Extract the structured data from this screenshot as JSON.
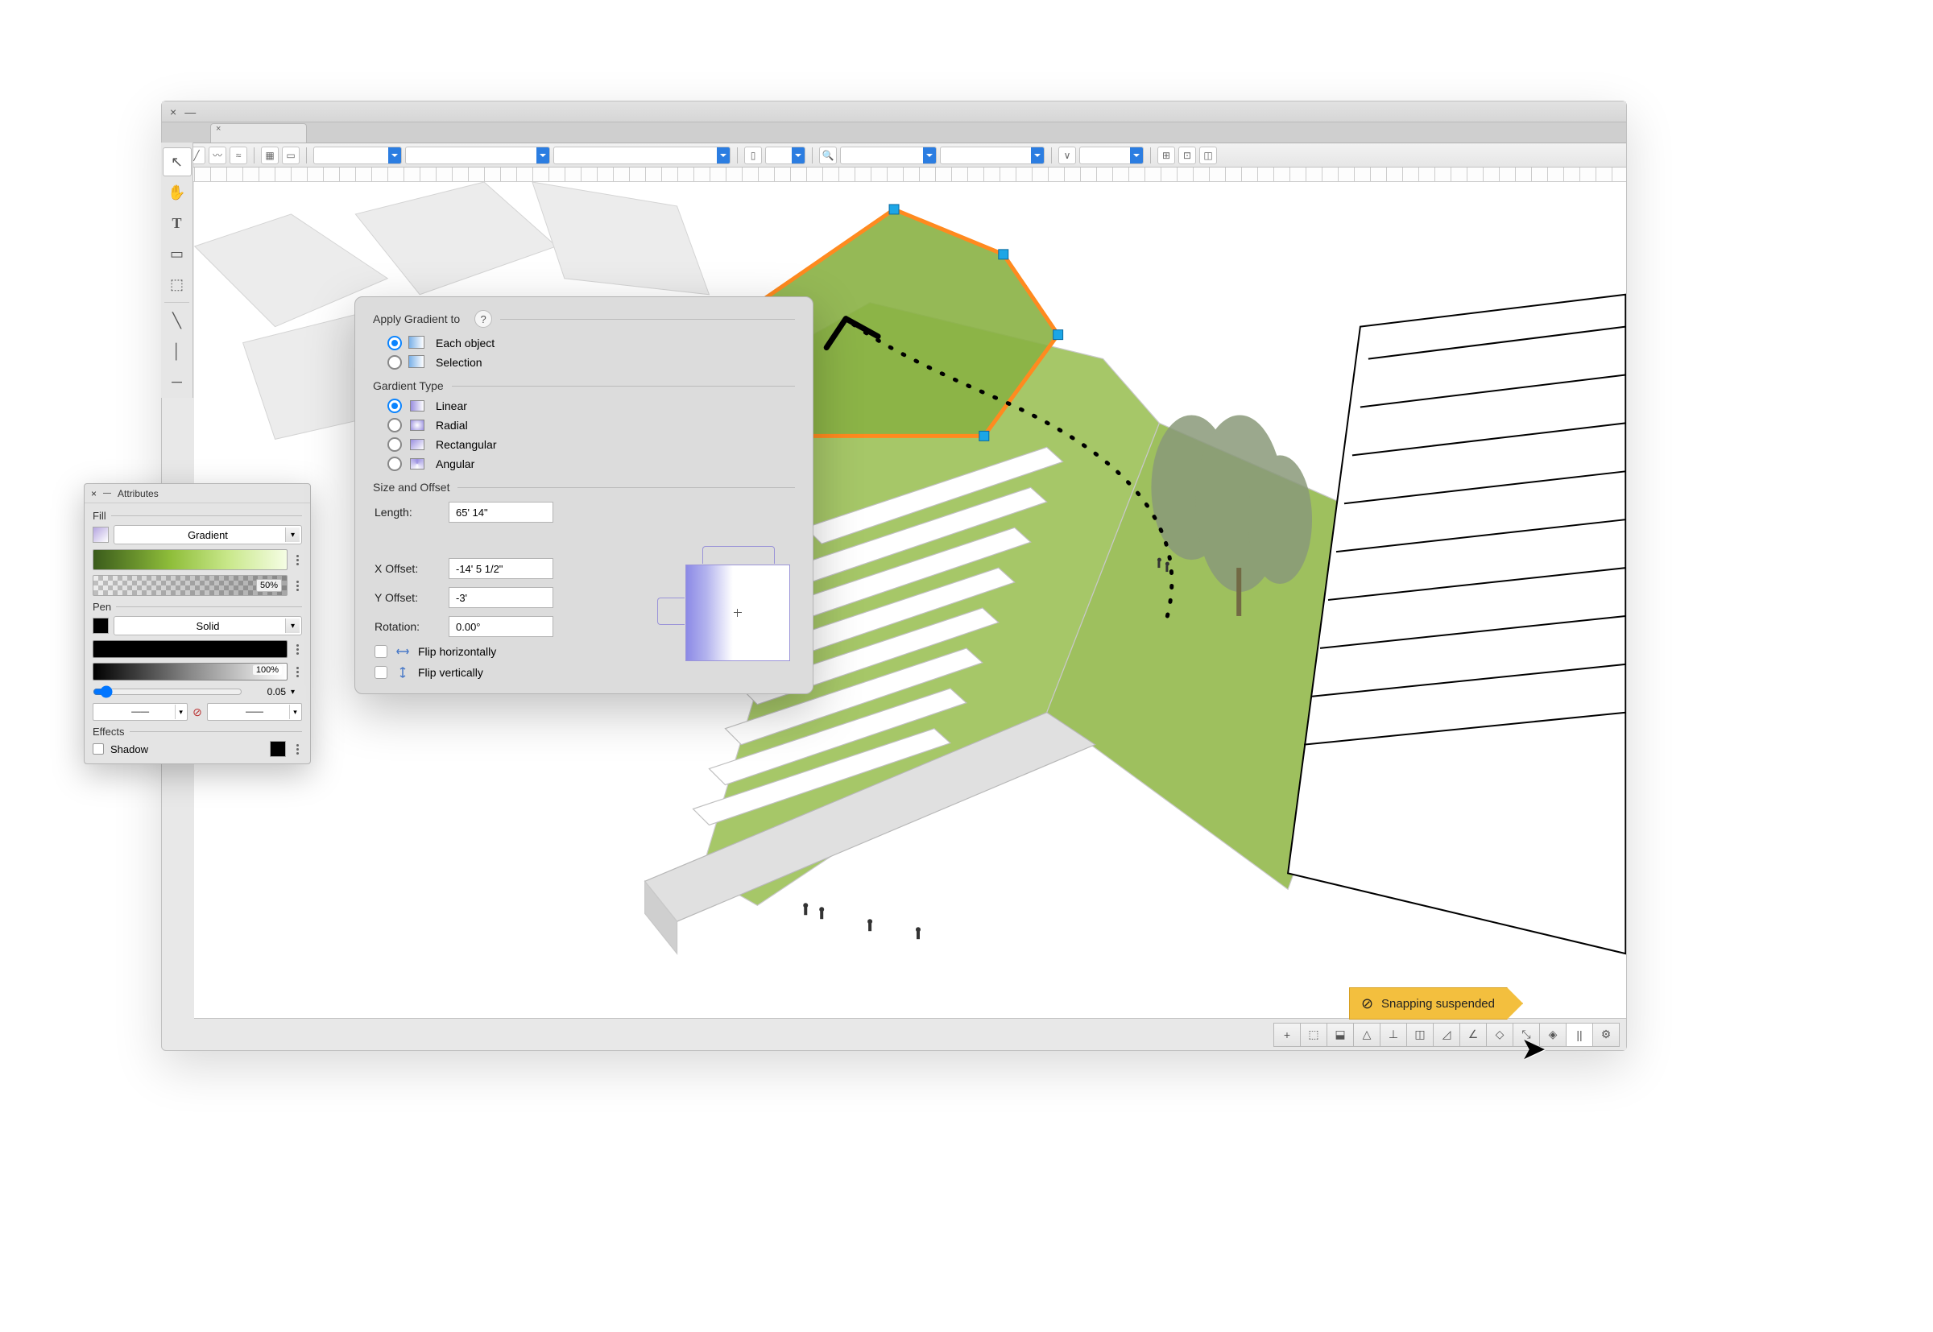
{
  "window": {
    "close_label": "×",
    "min_label": "—",
    "title": ""
  },
  "tabs": [
    {
      "close": "×"
    }
  ],
  "tool_palette": [
    {
      "name": "selection-tool",
      "glyph": "↖"
    },
    {
      "name": "pan-tool",
      "glyph": "✋"
    },
    {
      "name": "text-tool",
      "glyph": "T"
    },
    {
      "name": "rect-tool",
      "glyph": "▭"
    },
    {
      "name": "layer-tool",
      "glyph": "⬚"
    },
    {
      "name": "line-tool-1",
      "glyph": "╲"
    },
    {
      "name": "line-tool-2",
      "glyph": "│"
    },
    {
      "name": "line-tool-3",
      "glyph": "─"
    }
  ],
  "attributes": {
    "title": "Attributes",
    "fill": {
      "label": "Fill",
      "type": "Gradient",
      "opacity": "50%"
    },
    "pen": {
      "label": "Pen",
      "type": "Solid",
      "opacity": "100%",
      "width": "0.05"
    },
    "effects": {
      "label": "Effects",
      "shadow_label": "Shadow"
    }
  },
  "gradient_dialog": {
    "apply_label": "Apply Gradient to",
    "help": "?",
    "apply_options": [
      {
        "label": "Each object",
        "selected": true
      },
      {
        "label": "Selection",
        "selected": false
      }
    ],
    "type_label": "Gardient Type",
    "type_options": [
      {
        "label": "Linear",
        "selected": true,
        "kind": "linear"
      },
      {
        "label": "Radial",
        "selected": false,
        "kind": "radial"
      },
      {
        "label": "Rectangular",
        "selected": false,
        "kind": "rect"
      },
      {
        "label": "Angular",
        "selected": false,
        "kind": "ang"
      }
    ],
    "size_label": "Size and Offset",
    "fields": {
      "length_label": "Length:",
      "length": "65' 14\"",
      "x_offset_label": "X Offset:",
      "x_offset": "-14' 5 1/2\"",
      "y_offset_label": "Y Offset:",
      "y_offset": "-3'",
      "rotation_label": "Rotation:",
      "rotation": "0.00°"
    },
    "flip_h": "Flip horizontally",
    "flip_v": "Flip vertically"
  },
  "snapping": {
    "tooltip": "Snapping suspended",
    "buttons": [
      "+",
      "⬚",
      "⬓",
      "△",
      "⊥",
      "◫",
      "◿",
      "∠",
      "◇",
      "⤡",
      "◈",
      "||",
      "⚙"
    ]
  },
  "colors": {
    "accent": "#0b84ff",
    "selection_orange": "#ff8a1f",
    "handle_blue": "#1ca6e6",
    "grass_light": "#9fbf5a",
    "grass_dark": "#6e9433",
    "tooltip_bg": "#f3bf3e"
  }
}
